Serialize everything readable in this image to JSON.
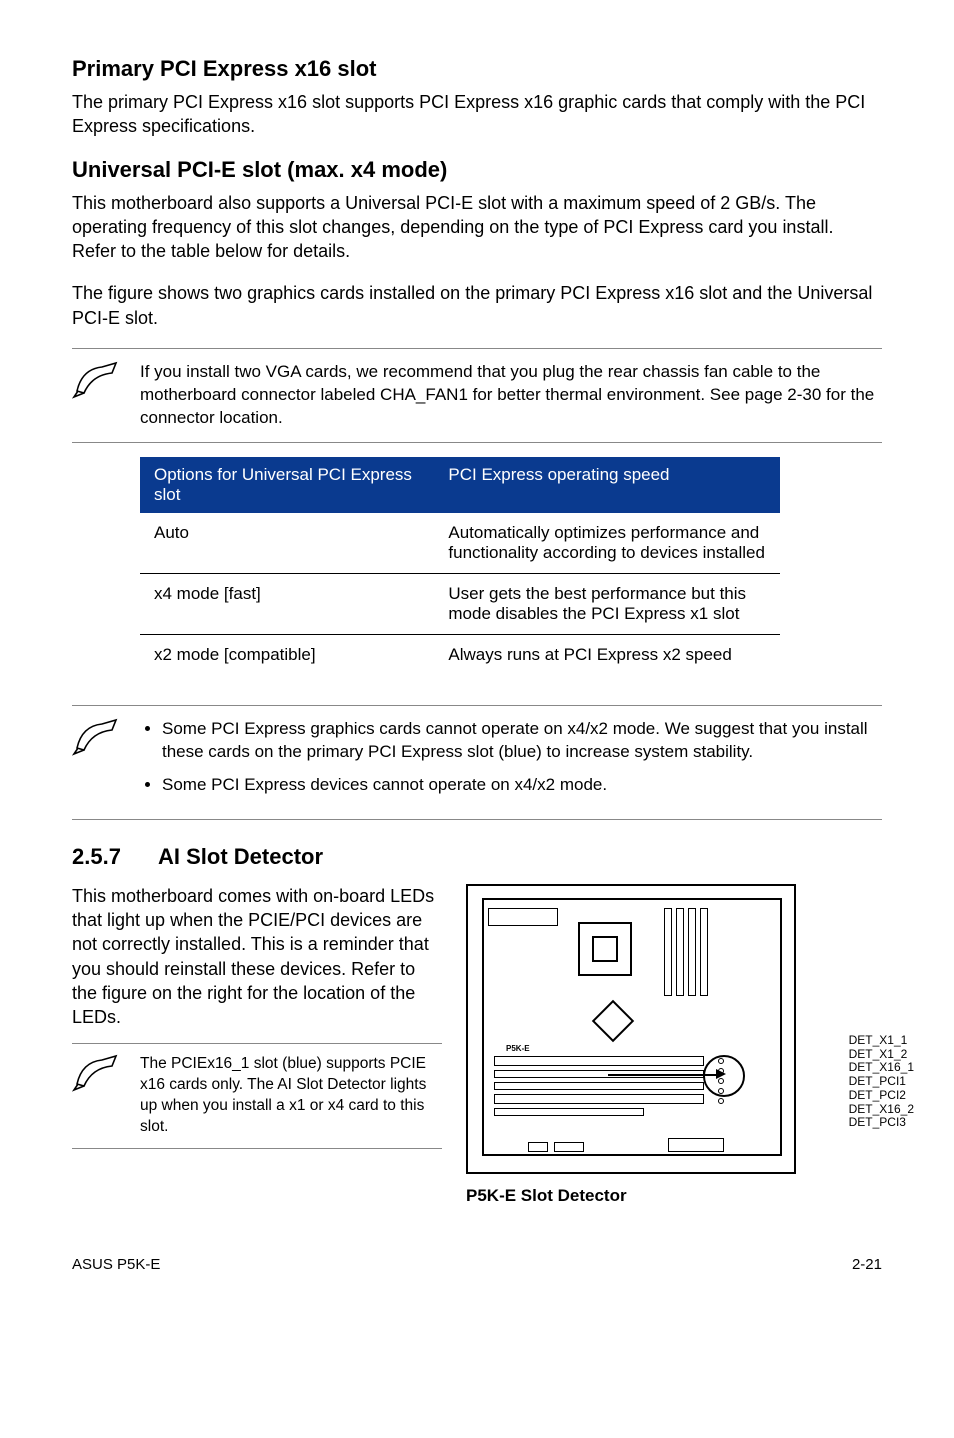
{
  "section1": {
    "heading": "Primary PCI Express x16 slot",
    "para": "The primary PCI Express x16 slot supports PCI Express x16 graphic cards that comply with the PCI Express specifications."
  },
  "section2": {
    "heading": "Universal PCI-E slot (max. x4 mode)",
    "para1": "This motherboard also supports a Universal PCI-E slot with a maximum speed of 2 GB/s. The operating frequency of this slot changes, depending on the type of PCI Express card you install. Refer to the table below for details.",
    "para2": "The figure shows two graphics cards installed on the primary PCI Express x16 slot and the Universal PCI-E slot."
  },
  "note1": {
    "text": "If you install two VGA cards, we recommend that you plug the rear chassis fan cable to the motherboard connector labeled CHA_FAN1 for better thermal environment. See page 2-30 for the connector location."
  },
  "table": {
    "h1": "Options for Universal PCI Express slot",
    "h2": "PCI Express operating speed",
    "r1c1": "Auto",
    "r1c2": "Automatically optimizes performance and functionality according to devices installed",
    "r2c1": "x4 mode [fast]",
    "r2c2": "User gets the best performance but this mode disables the PCI Express x1 slot",
    "r3c1": "x2 mode [compatible]",
    "r3c2": "Always runs at PCI Express x2 speed"
  },
  "note2": {
    "b1": "Some PCI Express graphics cards cannot operate on x4/x2 mode. We suggest that you install these cards on the primary PCI Express slot (blue) to increase system stability.",
    "b2": "Some PCI Express devices cannot operate on x4/x2 mode."
  },
  "section3": {
    "num": "2.5.7",
    "title": "AI Slot Detector",
    "para": "This motherboard comes with on-board LEDs that light up when the PCIE/PCI devices are not correctly installed. This is a reminder that you should reinstall these devices. Refer to the figure on the right for the location of the LEDs."
  },
  "note3": {
    "text": "The PCIEx16_1 slot (blue) supports PCIE x16 cards only. The AI Slot Detector lights up when you install a x1 or x4 card to this slot."
  },
  "board": {
    "caption": "P5K-E Slot Detector",
    "label1": "DET_X1_1",
    "label2": "DET_X1_2",
    "label3": "DET_X16_1",
    "label4": "DET_PCI1",
    "label5": "DET_PCI2",
    "label6": "DET_X16_2",
    "label7": "DET_PCI3",
    "silk": "P5K-E"
  },
  "footer": {
    "left": "ASUS P5K-E",
    "right": "2-21"
  }
}
